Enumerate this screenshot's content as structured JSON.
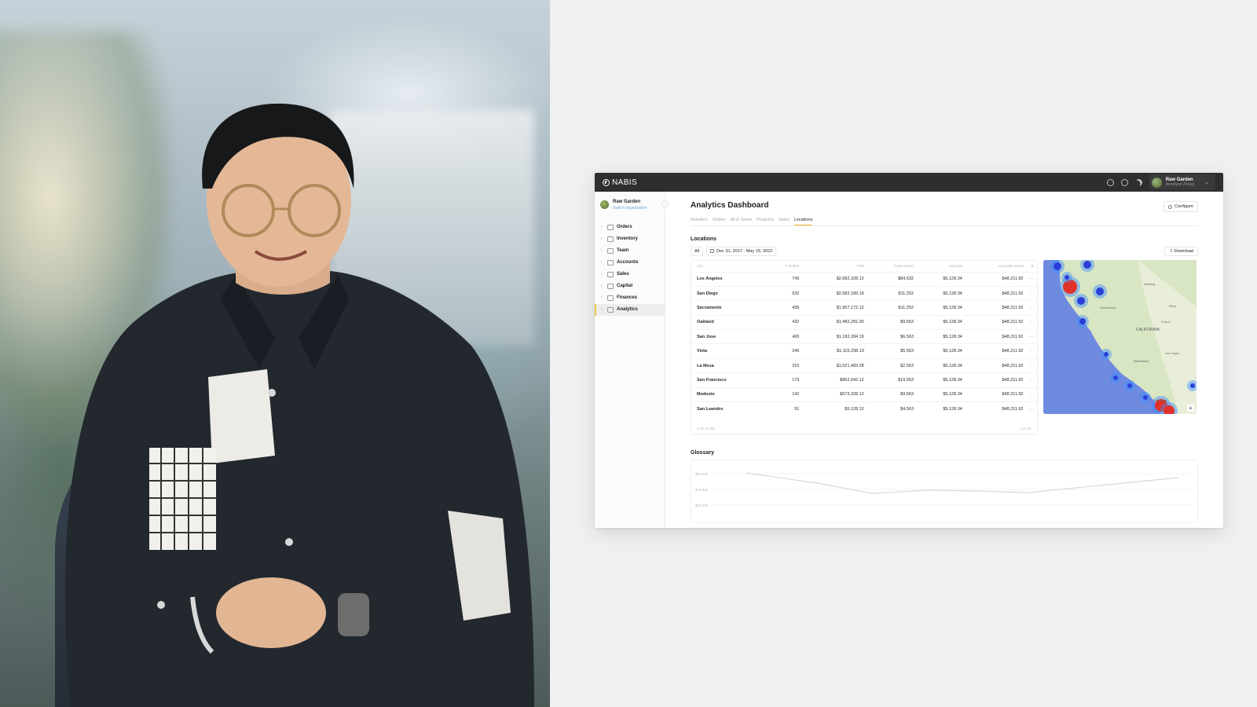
{
  "app": {
    "brand": "NABIS",
    "user": {
      "name": "Raw Garden",
      "subtitle": "Annelynn Zhang"
    }
  },
  "sidebar": {
    "org_name": "Raw Garden",
    "org_sub": "Switch organization",
    "items": [
      {
        "label": "Orders",
        "icon": "cart-icon"
      },
      {
        "label": "Inventory",
        "icon": "box-icon"
      },
      {
        "label": "Team",
        "icon": "users-icon"
      },
      {
        "label": "Accounts",
        "icon": "building-icon"
      },
      {
        "label": "Sales",
        "icon": "tag-icon"
      },
      {
        "label": "Capital",
        "icon": "dollar-icon"
      },
      {
        "label": "Finances",
        "icon": "card-icon"
      },
      {
        "label": "Analytics",
        "icon": "trend-icon",
        "active": true
      }
    ]
  },
  "page": {
    "title": "Analytics Dashboard",
    "configure_label": "Configure",
    "tabs": [
      "Retailers",
      "Orders",
      "All & Terms",
      "Products",
      "Sales",
      "Locations"
    ],
    "active_tab": "Locations"
  },
  "locations": {
    "title": "Locations",
    "filter_all": "All",
    "date_range": "Dec 31, 2017 - May 15, 2023",
    "download_label": "Download",
    "columns": [
      "City",
      "# Orders",
      "Total",
      "Trade spend",
      "Avg total",
      "Avg trade spend"
    ],
    "rows": [
      [
        "Los Angeles",
        "743",
        "$2,682,328.12",
        "$84,532",
        "$5,128.34",
        "$48,211.92"
      ],
      [
        "San Diego",
        "532",
        "$2,582,189.19",
        "$11,252",
        "$5,128.34",
        "$48,211.92"
      ],
      [
        "Sacramento",
        "435",
        "$1,967,172.12",
        "$11,252",
        "$5,128.34",
        "$48,211.92"
      ],
      [
        "Oakland",
        "432",
        "$1,482,281.00",
        "$9,563",
        "$5,128.34",
        "$48,211.92"
      ],
      [
        "San Jose",
        "426",
        "$1,182,284.19",
        "$6,563",
        "$5,128.34",
        "$48,211.92"
      ],
      [
        "Vista",
        "245",
        "$1,115,298.19",
        "$5,563",
        "$5,128.34",
        "$48,211.92"
      ],
      [
        "La Mesa",
        "215",
        "$1,021,483.28",
        "$2,563",
        "$5,128.34",
        "$48,211.92"
      ],
      [
        "San Francisco",
        "173",
        "$862,642.12",
        "$19,563",
        "$5,128.34",
        "$48,211.92"
      ],
      [
        "Modesto",
        "142",
        "$673,328.12",
        "$9,563",
        "$5,128.34",
        "$48,211.92"
      ],
      [
        "San Leandro",
        "51",
        "$5,128.12",
        "$4,563",
        "$5,128.34",
        "$48,211.92"
      ]
    ],
    "row_dash": "—",
    "footer_left": "1-10 of 180",
    "footer_right": "1 of 18"
  },
  "map": {
    "region_label": "CALIFORNIA",
    "city_labels": [
      "Redding",
      "Reno",
      "Sacramento",
      "Fresno",
      "Las Vegas",
      "Bakersfield",
      "San Diego"
    ],
    "zoom_label": "+"
  },
  "glossary": {
    "title": "Glossary",
    "y_ticks": [
      "$50,000",
      "$40,000",
      "$30,000"
    ]
  },
  "colors": {
    "topbar": "#2e2e2e",
    "accent": "#f2b12c",
    "map_water": "#6f8be0",
    "map_land": "#d9e6c4"
  }
}
